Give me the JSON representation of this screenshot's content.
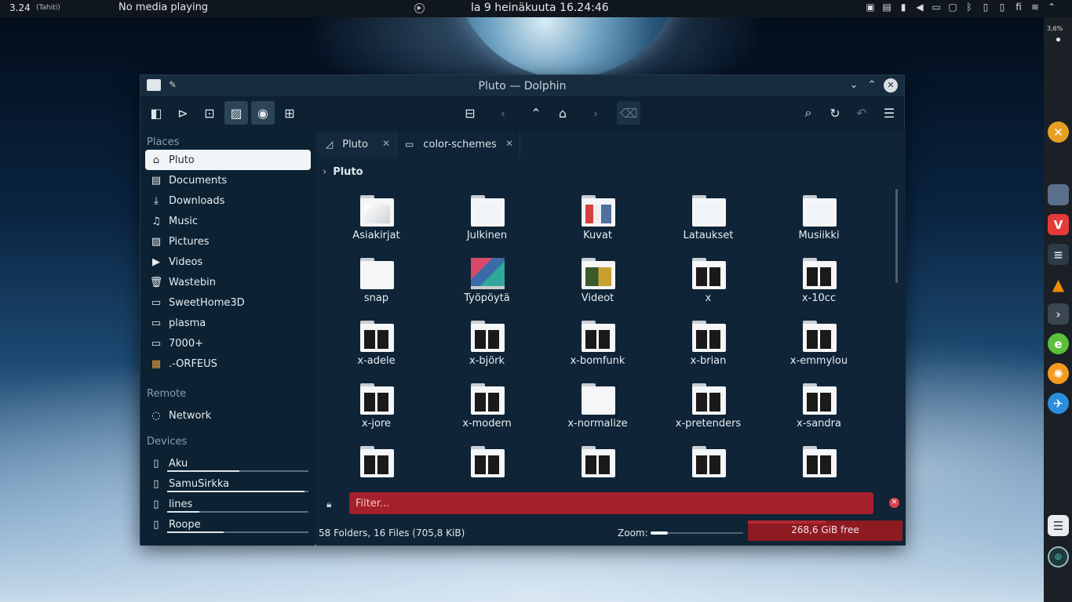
{
  "top_panel": {
    "clock_small": "3.24",
    "timezone": "(Tahiti)",
    "media": "No media playing",
    "datetime": "la 9 heinäkuuta 16.24:46",
    "tray": {
      "lang": "fi"
    }
  },
  "dock": {
    "cpu": "3,6%"
  },
  "window": {
    "title": "Pluto — Dolphin"
  },
  "sidebar": {
    "places_label": "Places",
    "places": [
      {
        "label": "Pluto",
        "icon": "home-icon"
      },
      {
        "label": "Documents",
        "icon": "document-icon"
      },
      {
        "label": "Downloads",
        "icon": "download-icon"
      },
      {
        "label": "Music",
        "icon": "music-icon"
      },
      {
        "label": "Pictures",
        "icon": "picture-icon"
      },
      {
        "label": "Videos",
        "icon": "video-icon"
      },
      {
        "label": "Wastebin",
        "icon": "trash-icon"
      },
      {
        "label": "SweetHome3D",
        "icon": "folder-icon"
      },
      {
        "label": "plasma",
        "icon": "folder-icon"
      },
      {
        "label": "7000+",
        "icon": "folder-icon"
      },
      {
        "label": ".-ORFEUS",
        "icon": "orfeus-icon"
      }
    ],
    "remote_label": "Remote",
    "remote": [
      {
        "label": "Network",
        "icon": "network-icon"
      }
    ],
    "devices_label": "Devices",
    "devices": [
      {
        "label": "Aku",
        "usage": 0.51
      },
      {
        "label": "SamuSirkka",
        "usage": 0.97
      },
      {
        "label": "lines",
        "usage": 0.23
      },
      {
        "label": "Roope",
        "usage": 0.4
      }
    ]
  },
  "tabs": [
    {
      "label": "Pluto"
    },
    {
      "label": "color-schemes"
    }
  ],
  "breadcrumb": "Pluto",
  "files": [
    {
      "label": "Asiakirjat",
      "thumb": "docs"
    },
    {
      "label": "Julkinen",
      "thumb": "public"
    },
    {
      "label": "Kuvat",
      "thumb": "pics"
    },
    {
      "label": "Lataukset",
      "thumb": "down"
    },
    {
      "label": "Musiikki",
      "thumb": "music"
    },
    {
      "label": "snap",
      "thumb": "plain"
    },
    {
      "label": "Työpöytä",
      "thumb": "desktop"
    },
    {
      "label": "Videot",
      "thumb": "videos"
    },
    {
      "label": "x",
      "thumb": "photos"
    },
    {
      "label": "x-10cc",
      "thumb": "photos"
    },
    {
      "label": "x-adele",
      "thumb": "photos"
    },
    {
      "label": "x-björk",
      "thumb": "photos"
    },
    {
      "label": "x-bomfunk",
      "thumb": "photos"
    },
    {
      "label": "x-brian",
      "thumb": "photos"
    },
    {
      "label": "x-emmylou",
      "thumb": "photos"
    },
    {
      "label": "x-jore",
      "thumb": "photos"
    },
    {
      "label": "x-modern",
      "thumb": "photos"
    },
    {
      "label": "x-normalize",
      "thumb": "plain"
    },
    {
      "label": "x-pretenders",
      "thumb": "photos"
    },
    {
      "label": "x-sandra",
      "thumb": "photos"
    },
    {
      "label": "",
      "thumb": "photos"
    },
    {
      "label": "",
      "thumb": "photos"
    },
    {
      "label": "",
      "thumb": "photos"
    },
    {
      "label": "",
      "thumb": "photos"
    },
    {
      "label": "",
      "thumb": "photos"
    }
  ],
  "filter": {
    "placeholder": "Filter..."
  },
  "status": {
    "info": "58 Folders, 16 Files (705,8 KiB)",
    "zoom_label": "Zoom:",
    "zoom_level": 0.19,
    "free": "268,6 GiB free",
    "disk_used": 0.5
  },
  "colors": {
    "accent_red": "#a4202a",
    "window_bg": "#0f2436",
    "selection": "#f1f4f6"
  }
}
